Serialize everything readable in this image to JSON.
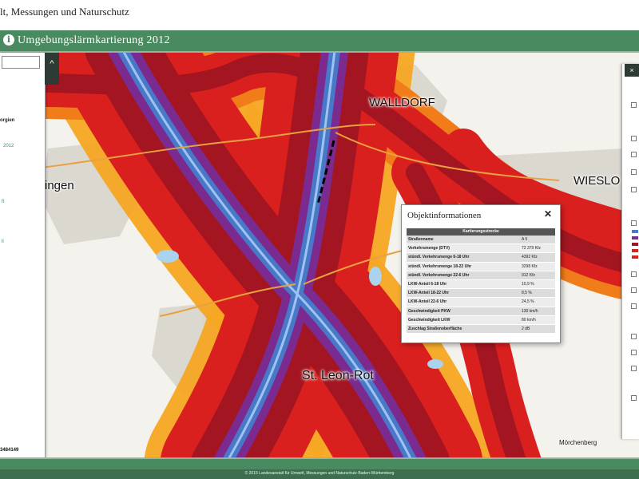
{
  "header": {
    "site_title": "lt, Messungen und Naturschutz",
    "app_title": "Umgebungslärmkartierung 2012",
    "info_icon_glyph": "i"
  },
  "map": {
    "places": [
      {
        "name": "WALLDORF"
      },
      {
        "name": "ingen"
      },
      {
        "name": "WIESLO"
      },
      {
        "name": "St. Leon-Rot"
      },
      {
        "name": "Mörchenberg"
      }
    ],
    "noise_colors": {
      "highest": "#7b2a8f",
      "very_high": "#4a78c8",
      "high": "#a31621",
      "medium_high": "#d9201e",
      "medium": "#f07d1a",
      "low": "#f5a623"
    },
    "icons": [
      "zoom-icon",
      "road-icon"
    ]
  },
  "left_panel": {
    "collapse_glyph": "^",
    "items": [
      {
        "text": "orgien",
        "style": "bold"
      },
      {
        "text": "2012",
        "style": "green"
      },
      {
        "text": "ft",
        "style": "green"
      },
      {
        "text": "ll",
        "style": "green"
      }
    ],
    "coordinate": "3484149"
  },
  "right_panel": {
    "tab_glyph": "×"
  },
  "popup": {
    "title": "Objektinformationen",
    "close_glyph": "✕",
    "table_header": "Kartierungsstrecke",
    "rows": [
      {
        "key": "Straßenname",
        "value": "A 5"
      },
      {
        "key": "Verkehrsmenge (DTV)",
        "value": "72 379 Kfz"
      },
      {
        "key": "stündl. Verkehrsmenge 6-18 Uhr",
        "value": "4392 Kfz"
      },
      {
        "key": "stündl. Verkehrsmenge 18-22 Uhr",
        "value": "3298 Kfz"
      },
      {
        "key": "stündl. Verkehrsmenge 22-6 Uhr",
        "value": "912 Kfz"
      },
      {
        "key": "LKW-Anteil 6-18 Uhr",
        "value": "10,9 %"
      },
      {
        "key": "LKW-Anteil 18-22 Uhr",
        "value": "8,5 %"
      },
      {
        "key": "LKW-Anteil 22-6 Uhr",
        "value": "24,5 %"
      },
      {
        "key": "Geschwindigkeit PKW",
        "value": "130 km/h"
      },
      {
        "key": "Geschwindigkeit LKW",
        "value": "80 km/h"
      },
      {
        "key": "Zuschlag Straßenoberfläche",
        "value": "2 dB"
      }
    ]
  },
  "footer": {
    "text": "© 2015 Landesanstalt für Umwelt, Messungen und Naturschutz Baden-Württemberg"
  }
}
